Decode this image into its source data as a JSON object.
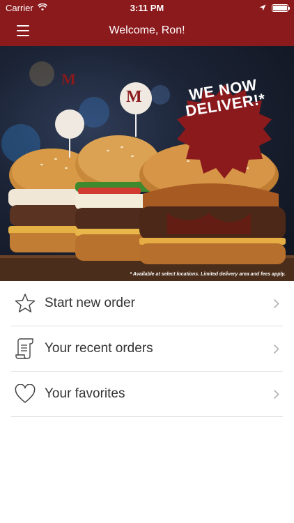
{
  "status_bar": {
    "carrier": "Carrier",
    "time": "3:11 PM",
    "battery_level": 1.0
  },
  "nav": {
    "title": "Welcome, Ron!"
  },
  "hero": {
    "badge_line1": "WE NOW",
    "badge_line2": "DELIVER!*",
    "disclaimer": "* Available at select locations. Limited delivery area and fees apply.",
    "pick_logo": "M"
  },
  "menu": {
    "items": [
      {
        "label": "Start new order",
        "icon": "star-icon"
      },
      {
        "label": "Your recent orders",
        "icon": "receipt-icon"
      },
      {
        "label": "Your favorites",
        "icon": "heart-icon"
      }
    ]
  },
  "colors": {
    "brand": "#8b1a1d",
    "text": "#333333",
    "divider": "#e0e0e0"
  }
}
